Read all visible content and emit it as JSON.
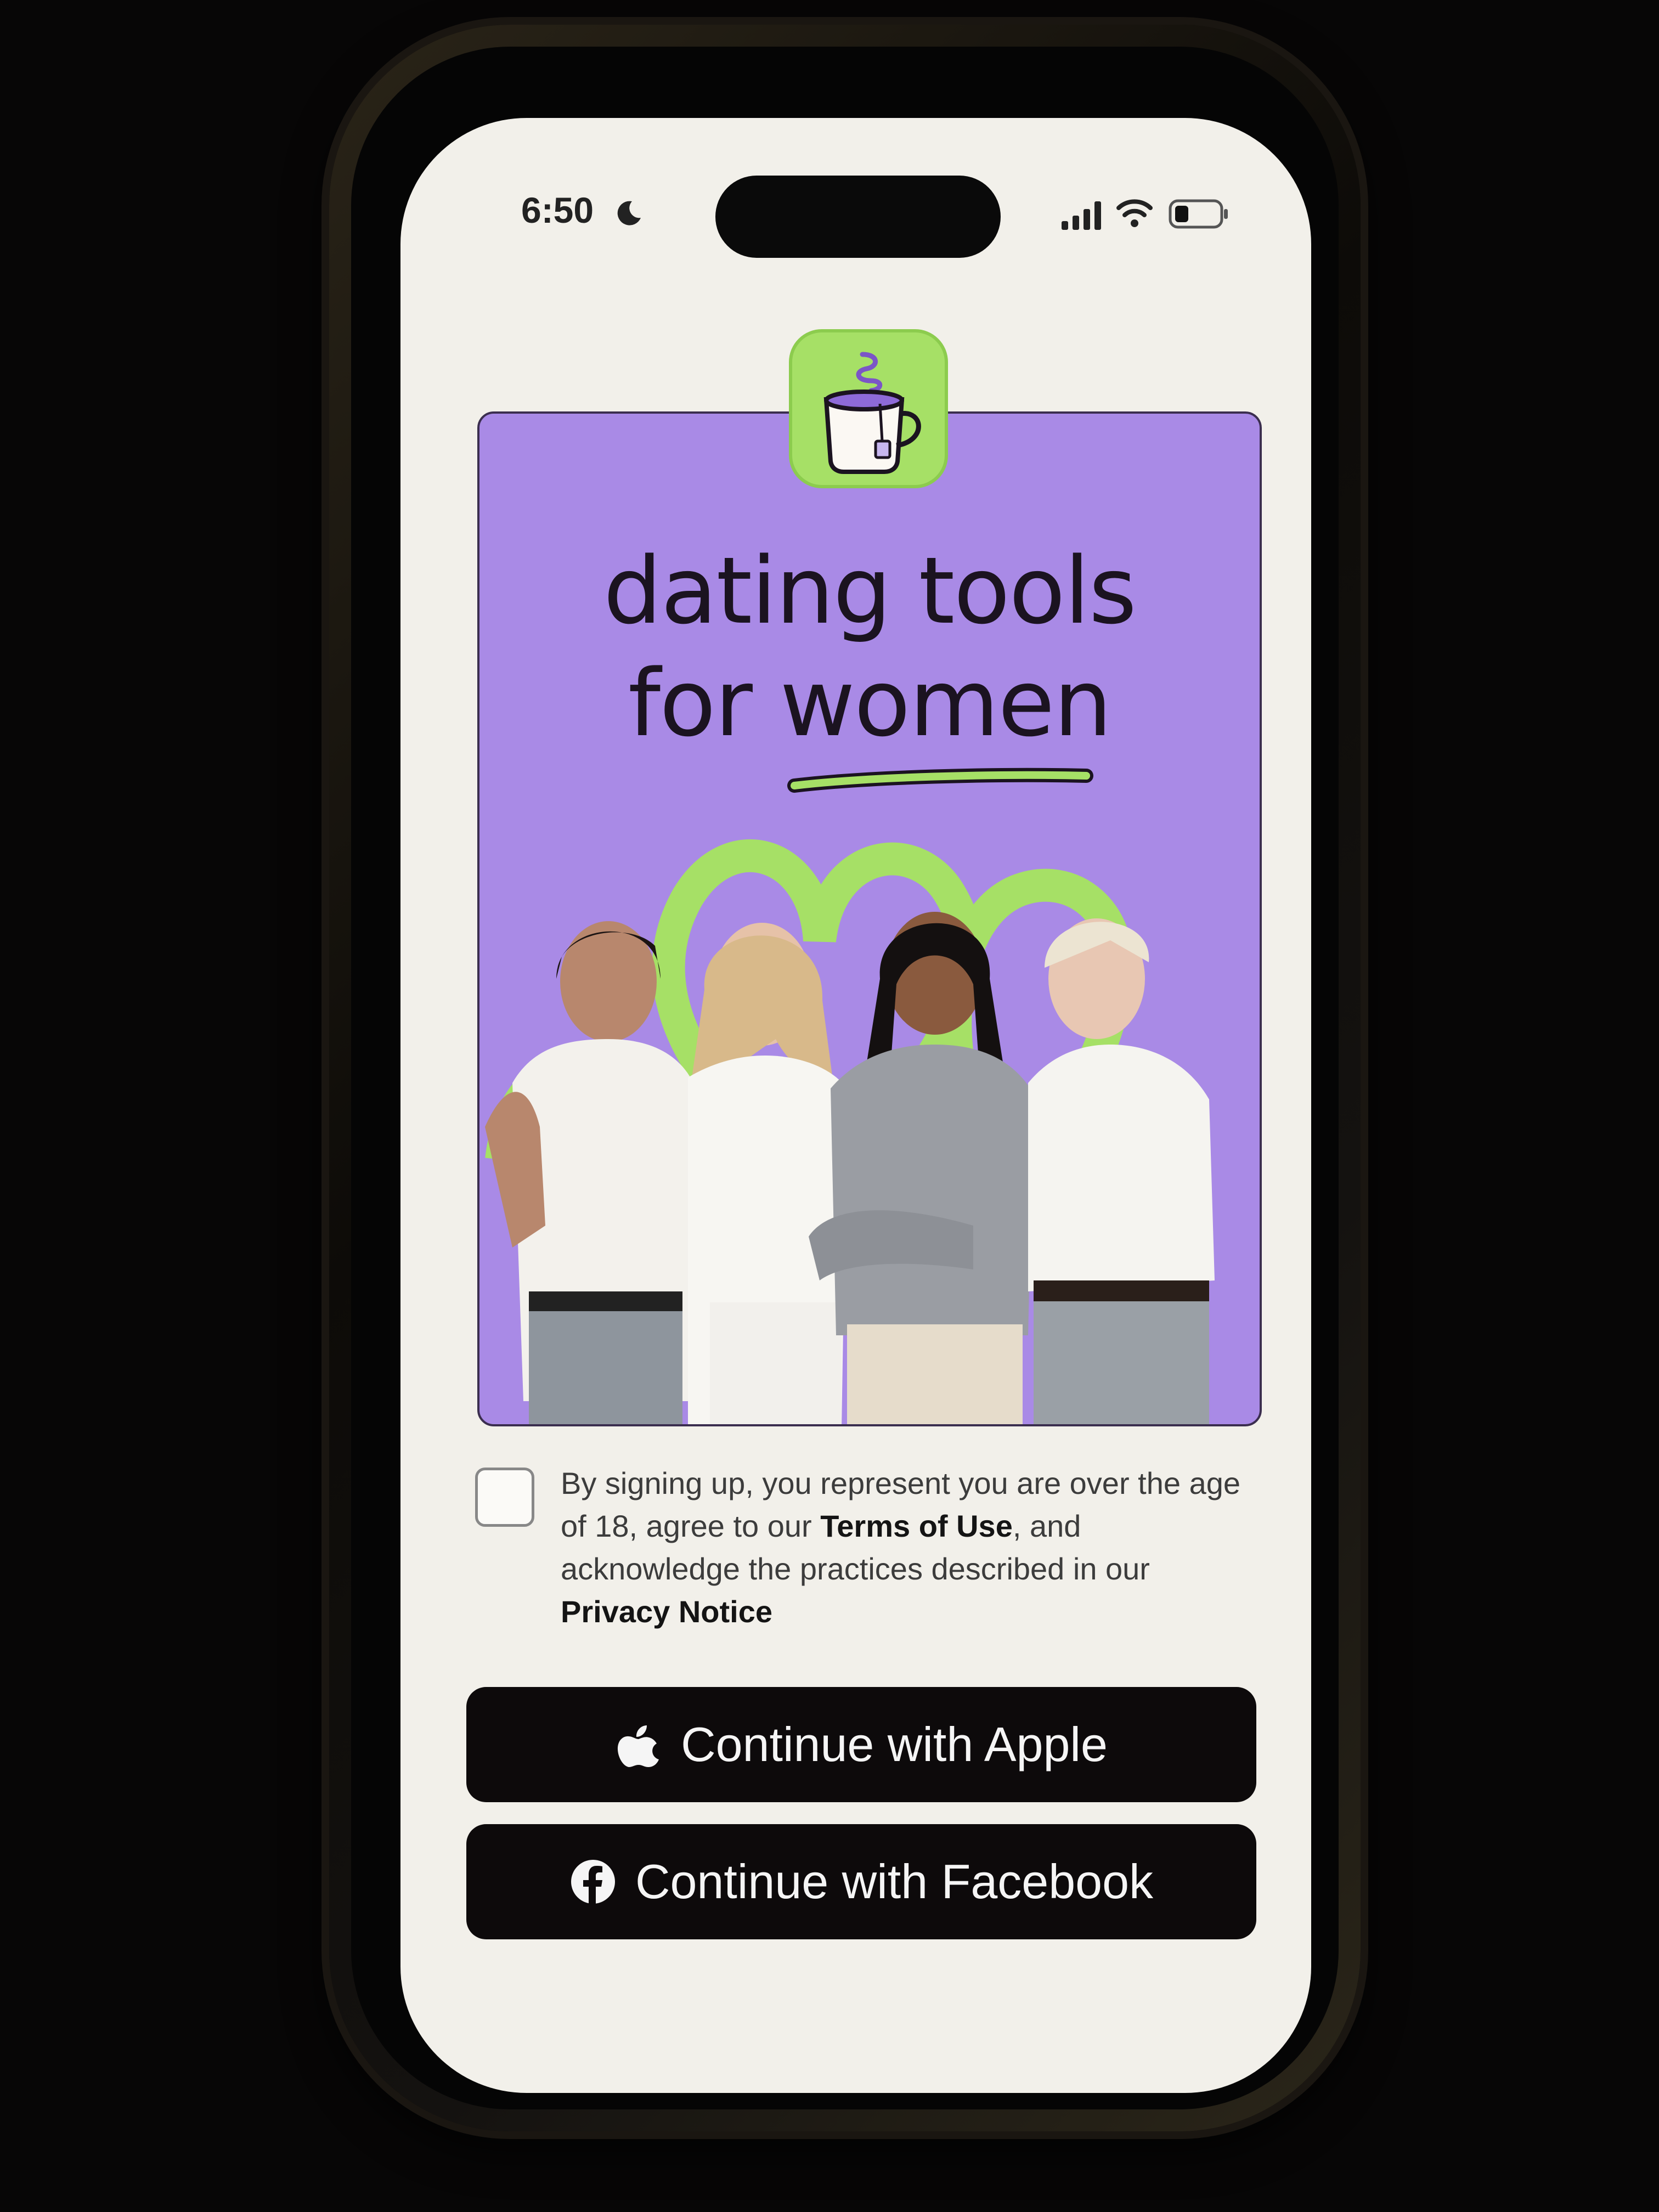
{
  "status_bar": {
    "time": "6:50",
    "icons": [
      "moon-icon",
      "cellular-signal-icon",
      "wifi-icon",
      "battery-icon"
    ]
  },
  "app": {
    "logo_icon": "tea-mug-icon",
    "brand_colors": {
      "green": "#a6e066",
      "purple": "#a98ae6",
      "dark": "#0d0a0b"
    }
  },
  "hero": {
    "title_line1": "dating tools",
    "title_line2": "for women"
  },
  "consent": {
    "checked": false,
    "text_part1": "By signing up, you represent you are over the age of 18, agree to our ",
    "terms_link": "Terms of Use",
    "text_part2": ", and acknowledge the practices described in our ",
    "privacy_link": "Privacy Notice"
  },
  "buttons": {
    "apple_label": "Continue with Apple",
    "apple_icon": "apple-logo-icon",
    "facebook_label": "Continue with Facebook",
    "facebook_icon": "facebook-logo-icon"
  }
}
